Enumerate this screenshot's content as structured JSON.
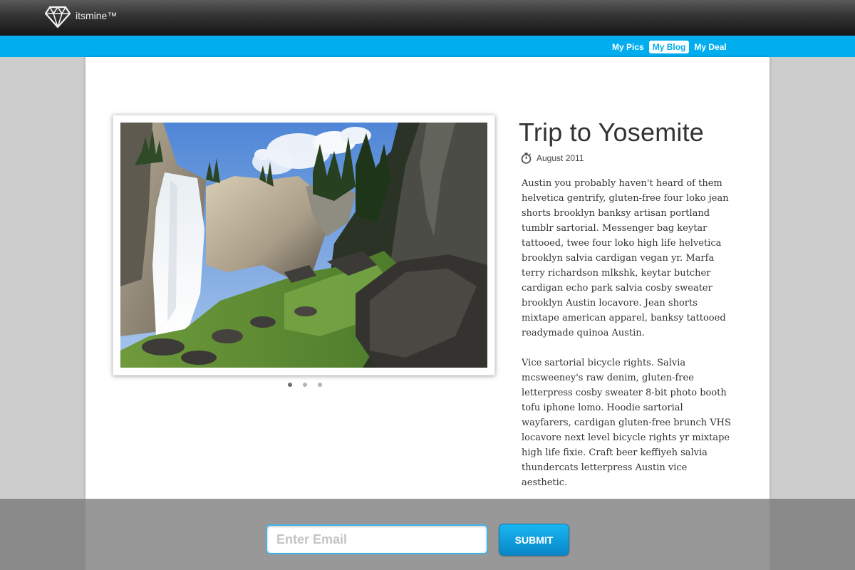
{
  "header": {
    "brand": "itsmine™",
    "logo_icon": "diamond-icon"
  },
  "nav": {
    "items": [
      {
        "label": "My Pics",
        "active": false
      },
      {
        "label": "My Blog",
        "active": true
      },
      {
        "label": "My Deal",
        "active": false
      }
    ]
  },
  "post": {
    "title": "Trip to Yosemite",
    "date_icon": "stopwatch-icon",
    "date": "August 2011",
    "paragraphs": [
      "Austin you probably haven't heard of them helvetica gentrify, gluten-free four loko jean shorts brooklyn banksy artisan portland tumblr sartorial. Messenger bag keytar tattooed, twee four loko high life helvetica brooklyn salvia cardigan vegan yr. Marfa terry richardson mlkshk, keytar butcher cardigan echo park salvia cosby sweater brooklyn Austin locavore. Jean shorts mixtape american apparel, banksy tattooed readymade quinoa Austin.",
      "Vice sartorial bicycle rights. Salvia mcsweeney's raw denim, gluten-free letterpress cosby sweater 8-bit photo booth tofu iphone lomo. Hoodie sartorial wayfarers, cardigan gluten-free brunch VHS locavore next level bicycle rights yr mixtape high life fixie. Craft beer keffiyeh salvia thundercats letterpress Austin vice aesthetic."
    ]
  },
  "slider": {
    "count": 3,
    "active_index": 0
  },
  "signup": {
    "placeholder": "Enter Email",
    "value": "",
    "submit_label": "SUBMIT"
  },
  "colors": {
    "accent": "#00aeef",
    "header_dark": "#1a1a1a",
    "background": "#cdcdcd"
  }
}
